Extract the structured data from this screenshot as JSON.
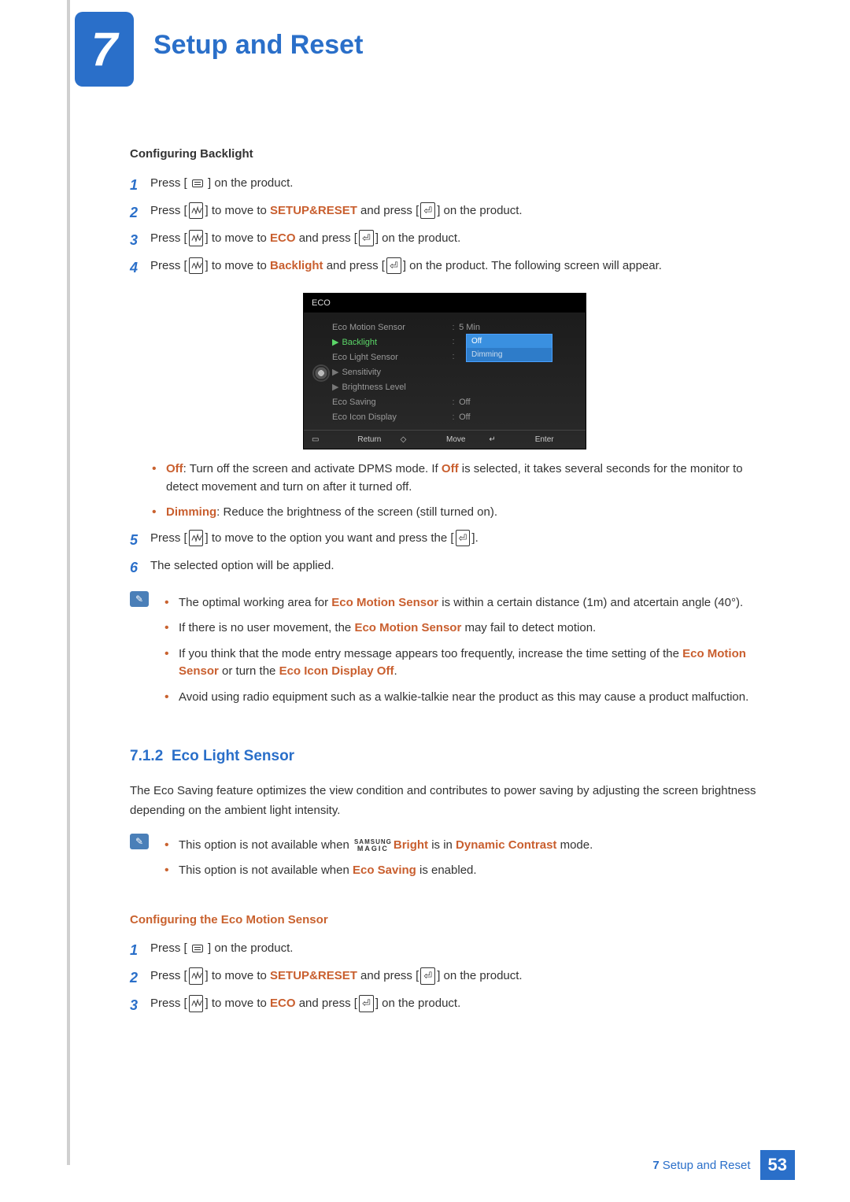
{
  "chapter": {
    "number": "7",
    "title": "Setup and Reset"
  },
  "sectionA": {
    "heading": "Configuring Backlight",
    "steps": {
      "s1": {
        "n": "1",
        "pre": "Press [ ",
        "post": " ] on the product."
      },
      "s2": {
        "n": "2",
        "pre": "Press [",
        "mid": "] to move to ",
        "kw": "SETUP&RESET",
        "mid2": " and press [",
        "post": "] on the product."
      },
      "s3": {
        "n": "3",
        "pre": "Press [",
        "mid": "] to move to ",
        "kw": "ECO",
        "mid2": " and press [",
        "post": "] on the product."
      },
      "s4": {
        "n": "4",
        "pre": "Press [",
        "mid": "] to move to ",
        "kw": "Backlight",
        "mid2": " and press [",
        "post": "] on the product. The following screen will appear."
      },
      "s5": {
        "n": "5",
        "pre": "Press [",
        "mid": "] to move to the option you want and press the [",
        "post": "]."
      },
      "s6": {
        "n": "6",
        "text": "The selected option will be applied."
      }
    },
    "bulletsA": {
      "b1": {
        "kw": "Off",
        "t1": ": Turn off the screen and activate DPMS mode. If ",
        "kw2": "Off",
        "t2": " is selected, it takes several seconds for the monitor to detect movement and turn on after it turned off."
      },
      "b2": {
        "kw": "Dimming",
        "t": ": Reduce the brightness of the screen (still turned on)."
      }
    },
    "note": {
      "n1": {
        "t1": "The optimal working area for ",
        "kw": "Eco Motion Sensor",
        "t2": " is within a certain distance (1m) and atcertain angle (40°)."
      },
      "n2": {
        "t1": "If there is no user movement, the ",
        "kw": "Eco Motion Sensor",
        "t2": " may fail to detect motion."
      },
      "n3": {
        "t1": "If you think that the mode entry message appears too frequently, increase the time setting of the ",
        "kw": "Eco Motion Sensor",
        "t2": " or turn the ",
        "kw2": "Eco Icon Display Off",
        "t3": "."
      },
      "n4": {
        "t": "Avoid using radio equipment such as a walkie-talkie near the product as this may cause a product malfuction."
      }
    }
  },
  "osd": {
    "title": "ECO",
    "rows": {
      "r1": {
        "label": "Eco Motion Sensor",
        "value": "5 Min"
      },
      "r2": {
        "label": "Backlight"
      },
      "r3": {
        "label": "Eco Light Sensor"
      },
      "r4": {
        "label": "Sensitivity"
      },
      "r5": {
        "label": "Brightness Level"
      },
      "r6": {
        "label": "Eco Saving",
        "value": "Off"
      },
      "r7": {
        "label": "Eco Icon Display",
        "value": "Off"
      }
    },
    "popup": {
      "opt1": "Off",
      "opt2": "Dimming"
    },
    "footer": {
      "f1": "Return",
      "f2": "Move",
      "f3": "Enter"
    }
  },
  "sectionB": {
    "num": "7.1.2",
    "title": "Eco Light Sensor",
    "intro": "The Eco Saving feature optimizes the view condition and contributes to power saving by adjusting the screen brightness depending on the ambient light intensity.",
    "note": {
      "n1": {
        "t1": "This option is not available when ",
        "kw": "Bright",
        "t2": " is in ",
        "kw2": "Dynamic Contrast",
        "t3": " mode."
      },
      "n2": {
        "t1": "This option is not available when ",
        "kw": "Eco Saving",
        "t2": " is enabled."
      }
    },
    "subheading": "Configuring the Eco Motion Sensor",
    "steps": {
      "s1": {
        "n": "1",
        "pre": "Press [ ",
        "post": " ] on the product."
      },
      "s2": {
        "n": "2",
        "pre": "Press [",
        "mid": "] to move to ",
        "kw": "SETUP&RESET",
        "mid2": " and press [",
        "post": "] on the product."
      },
      "s3": {
        "n": "3",
        "pre": "Press [",
        "mid": "] to move to ",
        "kw": "ECO",
        "mid2": " and press [",
        "post": "] on the product."
      }
    }
  },
  "magic": {
    "line1": "SAMSUNG",
    "line2": "MAGIC"
  },
  "footer": {
    "chapnum": "7",
    "label": "Setup and Reset",
    "page": "53"
  }
}
